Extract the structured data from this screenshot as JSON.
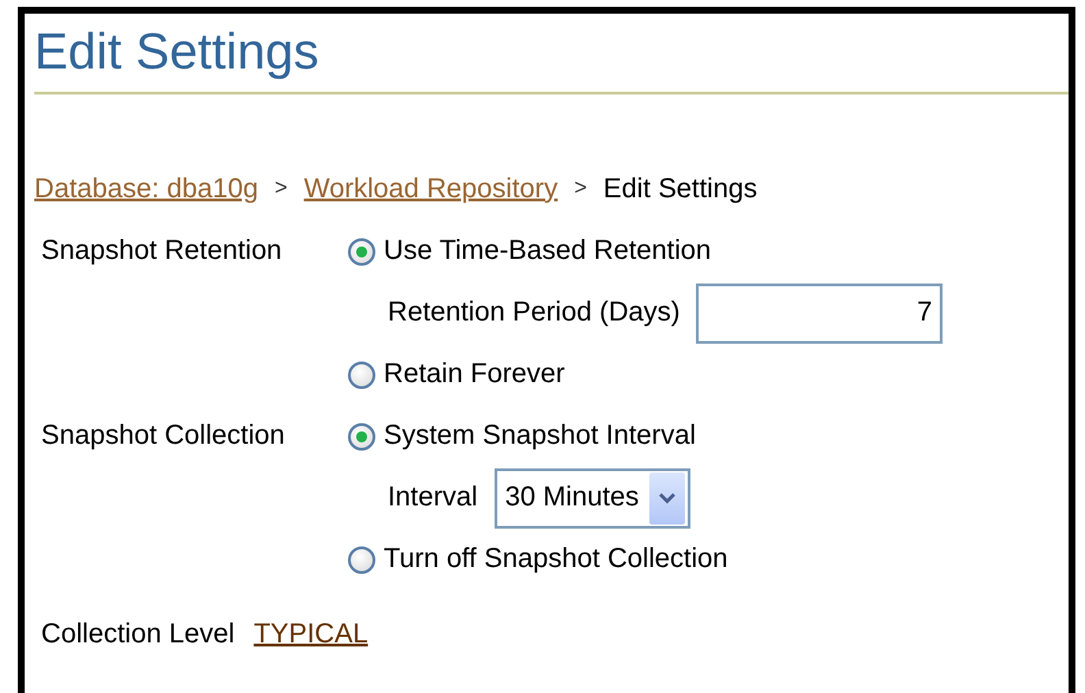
{
  "title": "Edit Settings",
  "breadcrumb": [
    {
      "kind": "link",
      "label": "Database: dba10g"
    },
    {
      "kind": "separator",
      "label": ">"
    },
    {
      "kind": "link",
      "label": "Workload Repository"
    },
    {
      "kind": "separator",
      "label": ">"
    },
    {
      "kind": "current",
      "label": "Edit Settings"
    }
  ],
  "sections": [
    {
      "label": "Snapshot Retention",
      "options": [
        {
          "label": "Use Time-Based Retention",
          "selected": true,
          "field": {
            "kind": "text",
            "label": "Retention Period (Days)",
            "value": "7"
          }
        },
        {
          "label": "Retain Forever",
          "selected": false
        }
      ]
    },
    {
      "label": "Snapshot Collection",
      "options": [
        {
          "label": "System Snapshot Interval",
          "selected": true,
          "field": {
            "kind": "select",
            "label": "Interval",
            "value": "30 Minutes"
          }
        },
        {
          "label": "Turn off Snapshot Collection",
          "selected": false
        }
      ]
    }
  ],
  "collection_level": {
    "label": "Collection Level",
    "value": "TYPICAL"
  }
}
